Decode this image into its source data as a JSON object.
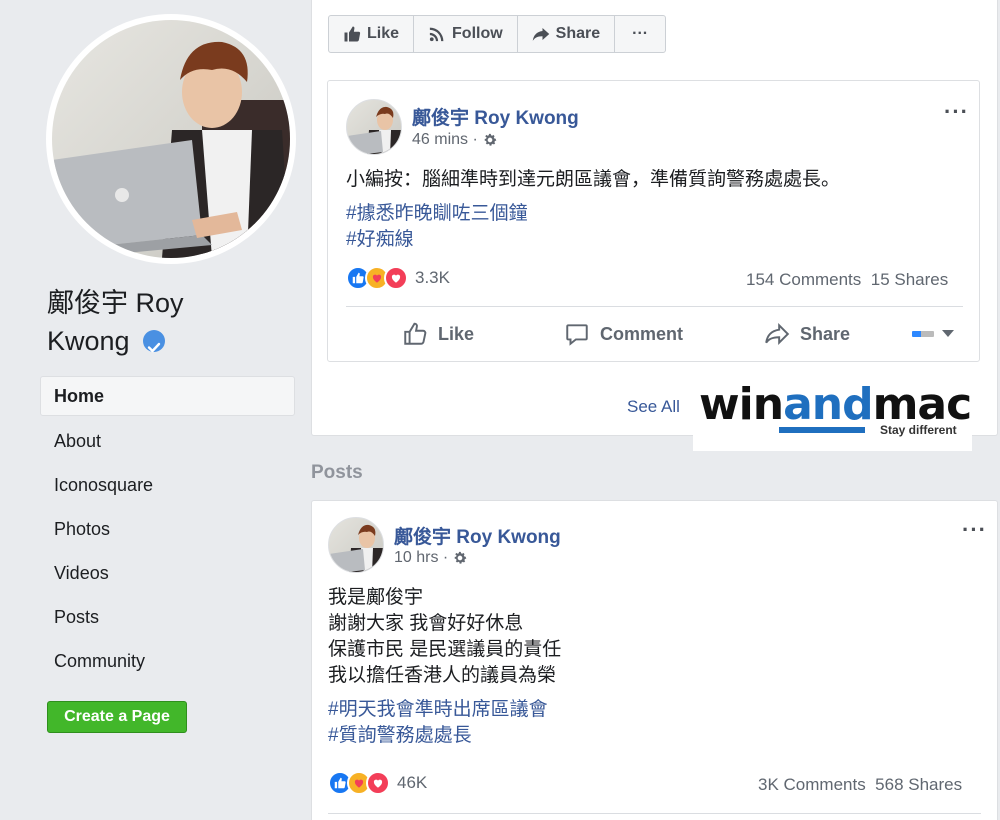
{
  "profile": {
    "name_line1": "鄺俊宇 Roy",
    "name_line2": "Kwong"
  },
  "nav": {
    "items": [
      "Home",
      "About",
      "Iconosquare",
      "Photos",
      "Videos",
      "Posts",
      "Community"
    ],
    "active": "Home"
  },
  "create_page_label": "Create a Page",
  "actionbar": {
    "like": "Like",
    "follow": "Follow",
    "share": "Share",
    "more": "···"
  },
  "posts": [
    {
      "author": "鄺俊宇 Roy Kwong",
      "time": "46 mins ·",
      "text": [
        "小編按：腦細準時到達元朗區議會，準備質詢警務處處長。"
      ],
      "hashtags": [
        "#據悉昨晚瞓咗三個鐘",
        "#好痴線"
      ],
      "reaction_count": "3.3K",
      "comments": "154 Comments",
      "shares": "15 Shares",
      "actions": {
        "like": "Like",
        "comment": "Comment",
        "share": "Share"
      }
    },
    {
      "author": "鄺俊宇 Roy Kwong",
      "time": "10 hrs ·",
      "text": [
        "我是鄺俊宇",
        "謝謝大家 我會好好休息",
        "保護市民 是民選議員的責任",
        "我以擔任香港人的議員為榮"
      ],
      "hashtags": [
        "#明天我會準時出席區議會",
        "#質詢警務處處長"
      ],
      "reaction_count": "46K",
      "comments": "3K Comments",
      "shares": "568 Shares"
    }
  ],
  "see_all": "See All",
  "section_posts": "Posts",
  "watermark": {
    "win": "win",
    "and": "and",
    "mac": "mac",
    "tagline": "Stay different"
  },
  "colors": {
    "link_blue": "#385898",
    "create_green": "#42b72a",
    "background": "#e9ebee"
  }
}
